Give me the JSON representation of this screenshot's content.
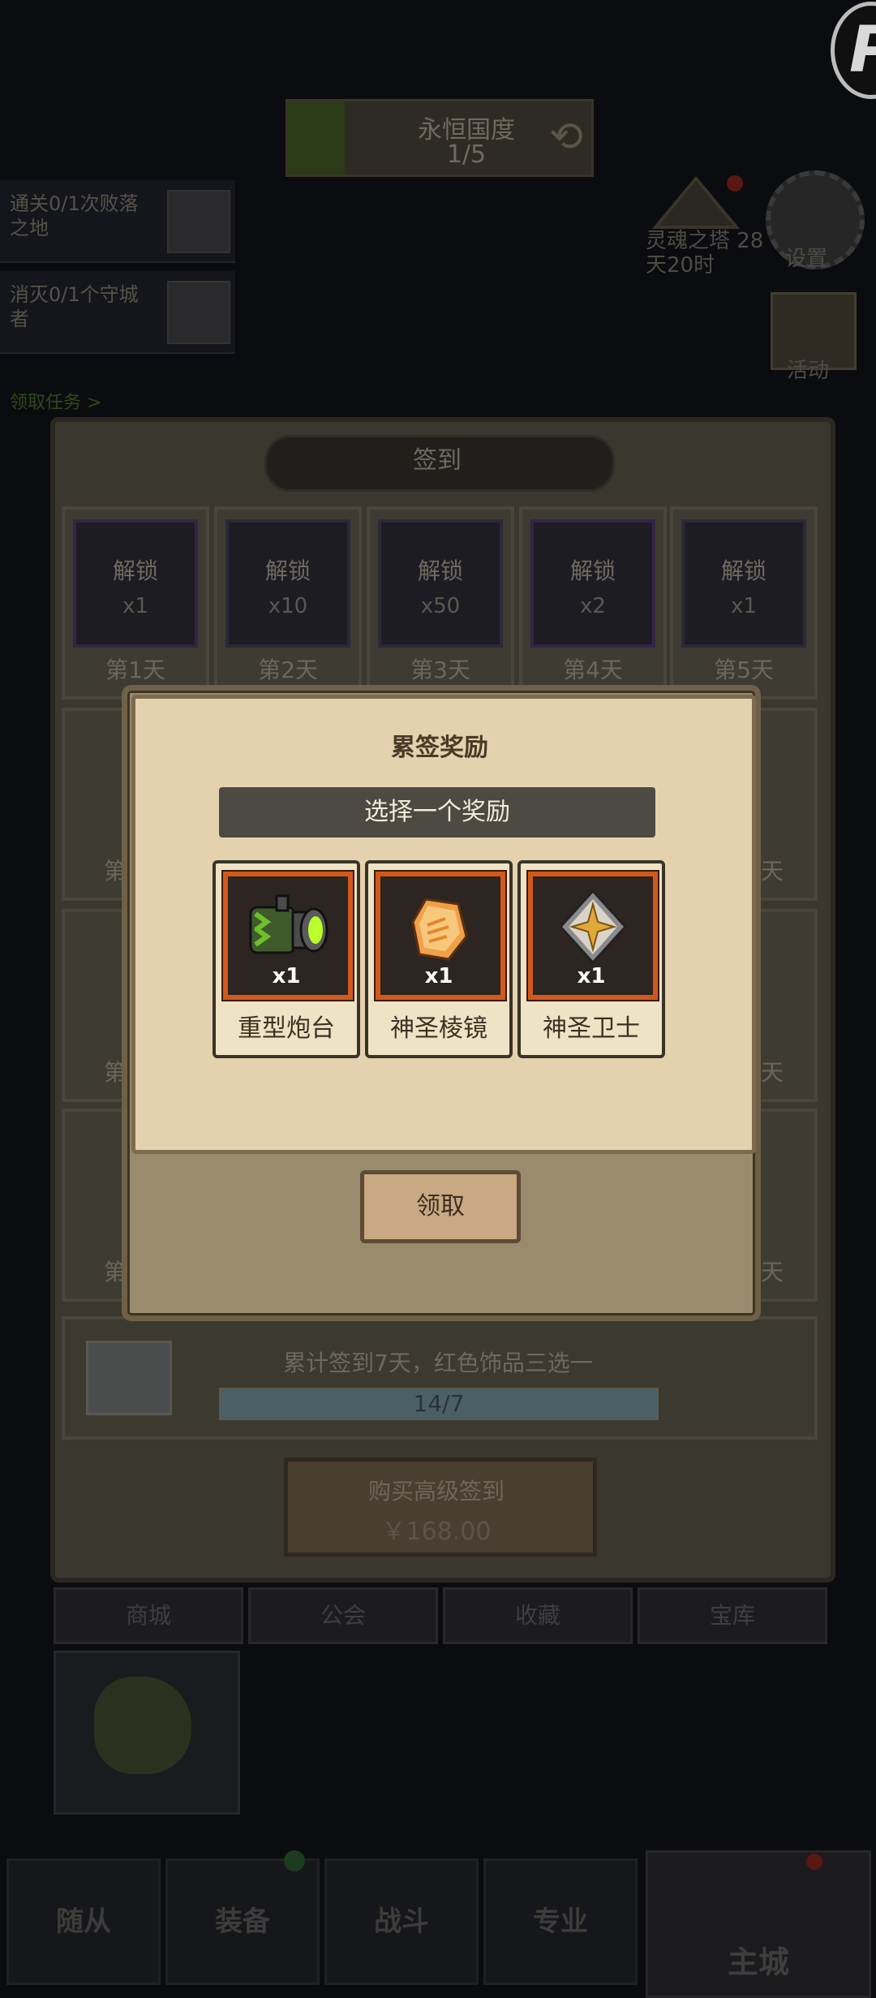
{
  "top_status": {
    "title": "永恒国度",
    "progress": "1/5"
  },
  "tasks": [
    {
      "text": "通关0/1次败落之地"
    },
    {
      "text": "消灭0/1个守城者"
    },
    {
      "text": "领取任务 >"
    }
  ],
  "right_menu": {
    "mystery_label": "灵魂之塔 28天20时",
    "settings_label": "设置",
    "activity_label": "活动"
  },
  "signin": {
    "title": "签到",
    "lock_label": "解锁",
    "days_row1": [
      {
        "day": "第1天",
        "qty": "x1"
      },
      {
        "day": "第2天",
        "qty": "x10"
      },
      {
        "day": "第3天",
        "qty": "x50"
      },
      {
        "day": "第4天",
        "qty": "x2"
      },
      {
        "day": "第5天",
        "qty": "x1"
      }
    ],
    "side_left_label": "第",
    "side_right_label": "天",
    "cumulative_text": "累计签到7天，红色饰品三选一",
    "cumulative_progress": "14/7",
    "cumulative_fill": 1.0,
    "buy_title": "购买高级签到",
    "buy_price": "￥168.00"
  },
  "bottom_tabs": [
    "商城",
    "公会",
    "收藏",
    "宝库"
  ],
  "nav": {
    "items": [
      "随从",
      "装备",
      "战斗",
      "专业"
    ],
    "home": "主城"
  },
  "modal": {
    "title": "累签奖励",
    "subtitle": "选择一个奖励",
    "rewards": [
      {
        "name": "重型炮台",
        "qty": "x1",
        "icon": "heavy-turret-icon"
      },
      {
        "name": "神圣棱镜",
        "qty": "x1",
        "icon": "holy-prism-icon"
      },
      {
        "name": "神圣卫士",
        "qty": "x1",
        "icon": "holy-guardian-icon"
      }
    ],
    "claim_label": "领取"
  },
  "colors": {
    "rarity_frame": "#d0591b",
    "paper": "#e4d2af",
    "overlay": "#0b0c10"
  }
}
